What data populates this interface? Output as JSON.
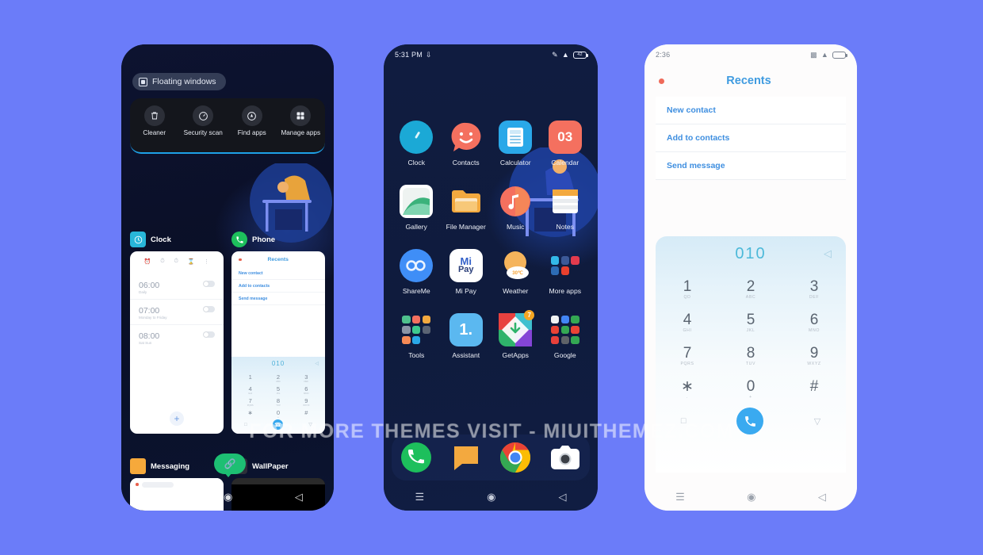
{
  "background_color": "#6b7cf9",
  "watermark": "FOR MORE THEMES VISIT - MIUITHEMEZ.COM",
  "phone_recents": {
    "floating_windows_label": "Floating windows",
    "quick_actions": [
      {
        "label": "Cleaner",
        "icon": "trash-icon"
      },
      {
        "label": "Security scan",
        "icon": "shield-scan-icon"
      },
      {
        "label": "Find apps",
        "icon": "search-apps-icon"
      },
      {
        "label": "Manage apps",
        "icon": "grid-apps-icon"
      }
    ],
    "tasks": [
      {
        "name": "Clock",
        "icon": "clock-icon"
      },
      {
        "name": "Phone",
        "icon": "phone-icon"
      },
      {
        "name": "Messaging",
        "icon": "messaging-icon"
      },
      {
        "name": "WallPaper",
        "icon": "wallpaper-icon"
      }
    ],
    "clock_thumb": {
      "tabs": [
        "alarm",
        "clock",
        "timer",
        "stopwatch",
        "more"
      ],
      "alarms": [
        {
          "time": "06:00",
          "sub": "Daily"
        },
        {
          "time": "07:00",
          "sub": "Monday to Friday"
        },
        {
          "time": "08:00",
          "sub": "Sat Sun"
        }
      ],
      "add_label": "+"
    },
    "phone_thumb": {
      "title": "Recents",
      "items": [
        "New contact",
        "Add to contacts",
        "Send message"
      ],
      "number": "010",
      "keys": [
        {
          "d": "1",
          "l": ""
        },
        {
          "d": "2",
          "l": "ABC"
        },
        {
          "d": "3",
          "l": "DEF"
        },
        {
          "d": "4",
          "l": "GHI"
        },
        {
          "d": "5",
          "l": "JKL"
        },
        {
          "d": "6",
          "l": "MNO"
        },
        {
          "d": "7",
          "l": "PQRS"
        },
        {
          "d": "8",
          "l": "TUV"
        },
        {
          "d": "9",
          "l": "WXYZ"
        },
        {
          "d": "∗",
          "l": ""
        },
        {
          "d": "0",
          "l": "+"
        },
        {
          "d": "#",
          "l": ""
        }
      ]
    },
    "navbar": [
      "menu-icon",
      "home-icon",
      "back-icon"
    ]
  },
  "phone_home": {
    "status": {
      "time": "5:31 PM",
      "icons": [
        "download-icon",
        "notification-icon",
        "wifi-icon",
        "battery-icon"
      ]
    },
    "apps": [
      {
        "name": "Clock",
        "icon": "clock-icon"
      },
      {
        "name": "Contacts",
        "icon": "contacts-icon"
      },
      {
        "name": "Calculator",
        "icon": "calculator-icon"
      },
      {
        "name": "Calendar",
        "icon": "calendar-icon",
        "day": "03"
      },
      {
        "name": "Gallery",
        "icon": "gallery-icon"
      },
      {
        "name": "File Manager",
        "icon": "file-manager-icon"
      },
      {
        "name": "Music",
        "icon": "music-icon"
      },
      {
        "name": "Notes",
        "icon": "notes-icon"
      },
      {
        "name": "ShareMe",
        "icon": "shareme-icon"
      },
      {
        "name": "Mi Pay",
        "icon": "mi-pay-icon"
      },
      {
        "name": "Weather",
        "icon": "weather-icon",
        "temp": "30℃"
      },
      {
        "name": "More apps",
        "icon": "folder-icon"
      },
      {
        "name": "Tools",
        "icon": "folder-icon"
      },
      {
        "name": "Assistant",
        "icon": "assistant-icon",
        "glyph": "1."
      },
      {
        "name": "GetApps",
        "icon": "getapps-icon",
        "badge": "7"
      },
      {
        "name": "Google",
        "icon": "folder-icon"
      }
    ],
    "dock": [
      {
        "name": "Phone",
        "icon": "phone-icon"
      },
      {
        "name": "Messaging",
        "icon": "messaging-icon"
      },
      {
        "name": "Browser",
        "icon": "chrome-icon"
      },
      {
        "name": "Camera",
        "icon": "camera-icon"
      }
    ],
    "navbar": [
      "menu-icon",
      "home-icon",
      "back-icon"
    ]
  },
  "phone_dialer": {
    "status": {
      "time": "2:36",
      "icons": [
        "signal-icon",
        "wifi-icon",
        "battery-icon"
      ]
    },
    "title": "Recents",
    "actions": [
      "New contact",
      "Add to contacts",
      "Send message"
    ],
    "number": "010",
    "backspace_icon": "backspace-icon",
    "keys": [
      {
        "d": "1",
        "l": "QD"
      },
      {
        "d": "2",
        "l": "ABC"
      },
      {
        "d": "3",
        "l": "DEF"
      },
      {
        "d": "4",
        "l": "GHI"
      },
      {
        "d": "5",
        "l": "JKL"
      },
      {
        "d": "6",
        "l": "MNO"
      },
      {
        "d": "7",
        "l": "PQRS"
      },
      {
        "d": "8",
        "l": "TUV"
      },
      {
        "d": "9",
        "l": "WXYZ"
      },
      {
        "d": "∗",
        "l": "."
      },
      {
        "d": "0",
        "l": "+"
      },
      {
        "d": "#",
        "l": ""
      }
    ],
    "bottom": {
      "left_icon": "keypad-square-icon",
      "call_icon": "call-icon",
      "right_icon": "hide-icon"
    },
    "navbar": [
      "menu-icon",
      "home-icon",
      "back-icon"
    ],
    "accent": "#3aaaf0"
  }
}
